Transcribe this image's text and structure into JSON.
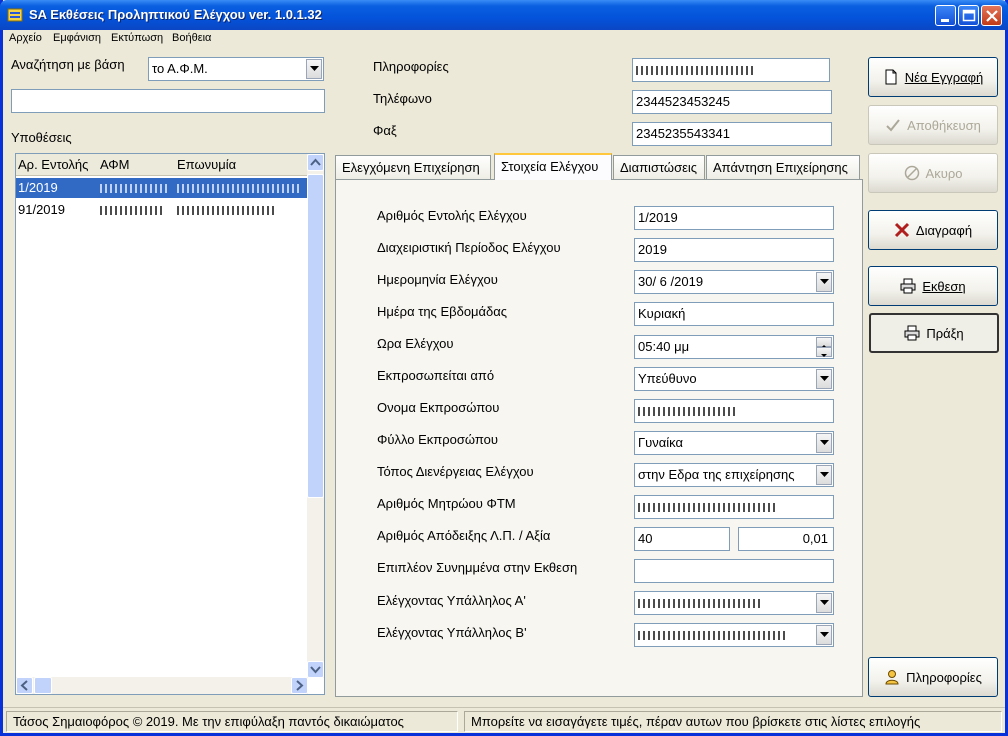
{
  "window": {
    "title": "SA Εκθέσεις Προληπτικού Ελέγχου ver. 1.0.1.32"
  },
  "menu": [
    "Αρχείο",
    "Εμφάνιση",
    "Εκτύπωση",
    "Βοήθεια"
  ],
  "search": {
    "label": "Αναζήτηση με βάση",
    "by_value": "το Α.Φ.Μ.",
    "text": ""
  },
  "cases": {
    "label": "Υποθέσεις",
    "columns": [
      "Αρ. Εντολής",
      "ΑΦΜ",
      "Επωνυμία"
    ],
    "rows": [
      {
        "order_no": "1/2019",
        "afm": "",
        "name": ""
      },
      {
        "order_no": "91/2019",
        "afm": "",
        "name": ""
      }
    ]
  },
  "info": {
    "info_label": "Πληροφορίες",
    "info_value": "",
    "phone_label": "Τηλέφωνο",
    "phone_value": "2344523453245",
    "fax_label": "Φαξ",
    "fax_value": "2345235543341"
  },
  "tabs": [
    "Ελεγχόμενη Επιχείρηση",
    "Στοιχεία Ελέγχου",
    "Διαπιστώσεις",
    "Απάντηση Επιχείρησης"
  ],
  "form": {
    "order_no_label": "Αριθμός Εντολής Ελέγχου",
    "order_no": "1/2019",
    "period_label": "Διαχειριστική Περίοδος Ελέγχου",
    "period": "2019",
    "date_label": "Ημερομηνία Ελέγχου",
    "date": "30/ 6 /2019",
    "weekday_label": "Ημέρα της Εβδομάδας",
    "weekday": "Κυριακή",
    "time_label": "Ωρα Ελέγχου",
    "time": "05:40 μμ",
    "represented_label": "Εκπροσωπείται από",
    "represented": "Υπεύθυνο",
    "rep_name_label": "Ονομα Εκπροσώπου",
    "rep_name": "",
    "rep_gender_label": "Φύλλο Εκπροσώπου",
    "rep_gender": "Γυναίκα",
    "place_label": "Τόπος Διενέργειας Ελέγχου",
    "place": "στην Εδρα της επιχείρησης",
    "ftm_label": "Αριθμός Μητρώου ΦΤΜ",
    "ftm": "",
    "receipt_label": "Αριθμός Απόδειξης Λ.Π. / Αξία",
    "receipt_no": "40",
    "receipt_value": "0,01",
    "attachments_label": "Επιπλέον Συνημμένα στην Εκθεση",
    "attachments": "",
    "officer_a_label": "Ελέγχοντας Υπάλληλος Α'",
    "officer_a": "",
    "officer_b_label": "Ελέγχοντας Υπάλληλος Β'",
    "officer_b": ""
  },
  "buttons": {
    "new": "Νέα Εγγραφή",
    "save": "Αποθήκευση",
    "cancel": "Ακυρο",
    "delete": "Διαγραφή",
    "report": "Εκθεση",
    "act": "Πράξη",
    "info": "Πληροφορίες"
  },
  "status": {
    "left": "Τάσος Σημαιοφόρος © 2019. Με την επιφύλαξη παντός δικαιώματος",
    "right": "Μπορείτε να εισαγάγετε τιμές, πέραν αυτων που βρίσκετε στις λίστες επιλογής"
  },
  "colors": {
    "selection": "#316ac5",
    "titlebar": "#0453da",
    "delete_icon": "#b01e1e"
  }
}
